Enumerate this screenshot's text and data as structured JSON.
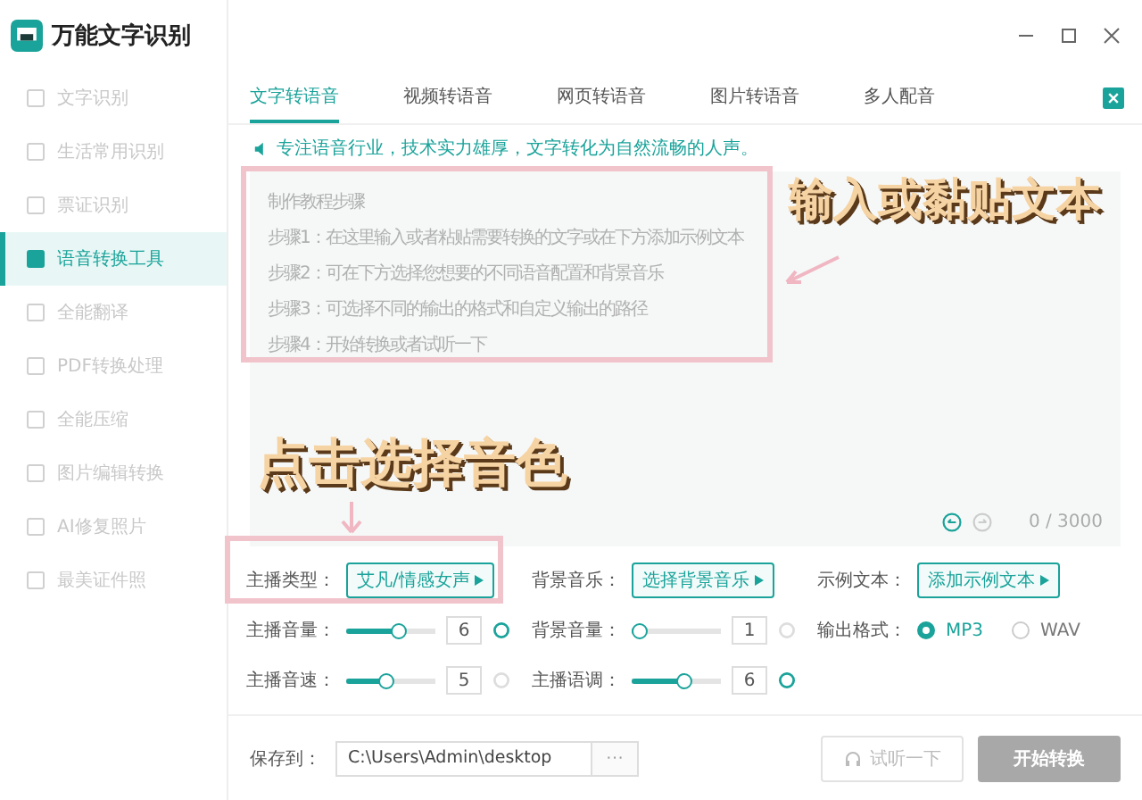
{
  "app": {
    "title": "万能文字识别"
  },
  "sidebar": {
    "items": [
      {
        "label": "文字识别",
        "selected": false
      },
      {
        "label": "生活常用识别",
        "selected": false
      },
      {
        "label": "票证识别",
        "selected": false
      },
      {
        "label": "语音转换工具",
        "selected": true
      },
      {
        "label": "全能翻译",
        "selected": false
      },
      {
        "label": "PDF转换处理",
        "selected": false
      },
      {
        "label": "全能压缩",
        "selected": false
      },
      {
        "label": "图片编辑转换",
        "selected": false
      },
      {
        "label": "AI修复照片",
        "selected": false
      },
      {
        "label": "最美证件照",
        "selected": false
      }
    ]
  },
  "tabs": [
    {
      "label": "文字转语音",
      "selected": true
    },
    {
      "label": "视频转语音",
      "selected": false
    },
    {
      "label": "网页转语音",
      "selected": false
    },
    {
      "label": "图片转语音",
      "selected": false
    },
    {
      "label": "多人配音",
      "selected": false
    }
  ],
  "notice": "专注语音行业，技术实力雄厚，文字转化为自然流畅的人声。",
  "editor": {
    "guide_lines": [
      "制作教程步骤",
      "步骤1：在这里输入或者粘贴需要转换的文字或在下方添加示例文本",
      "步骤2：可在下方选择您想要的不同语音配置和背景音乐",
      "步骤3：可选择不同的输出的格式和自定义输出的路径",
      "步骤4：开始转换或者试听一下"
    ],
    "counter": "0 / 3000"
  },
  "settings": {
    "pickers": [
      {
        "label": "主播类型：",
        "value": "艾凡/情感女声"
      },
      {
        "label": "背景音乐：",
        "value": "选择背景音乐"
      },
      {
        "label": "示例文本：",
        "value": "添加示例文本"
      }
    ],
    "sliders": [
      {
        "label": "主播音量：",
        "level": 0.6,
        "reading": "6",
        "reset_enabled": true
      },
      {
        "label": "背景音量：",
        "level": 0,
        "reading": "1",
        "reset_enabled": false
      },
      {
        "label": "主播音速：",
        "level": 0.45,
        "reading": "5",
        "reset_enabled": false
      },
      {
        "label": "主播语调：",
        "level": 0.6,
        "reading": "6",
        "reset_enabled": true
      }
    ],
    "output_format": {
      "label": "输出格式：",
      "options": [
        {
          "label": "MP3",
          "selected": true
        },
        {
          "label": "WAV",
          "selected": false
        }
      ]
    }
  },
  "save": {
    "label": "保存到：",
    "path": "C:\\Users\\Admin\\desktop",
    "browse": "···"
  },
  "buttons": [
    {
      "label": "试听一下",
      "kind": "preview",
      "disabled": true
    },
    {
      "label": "开始转换",
      "kind": "start",
      "disabled": true
    }
  ],
  "annotations": [
    {
      "text": "输入或黏贴文本"
    },
    {
      "text": "点击选择音色"
    }
  ]
}
